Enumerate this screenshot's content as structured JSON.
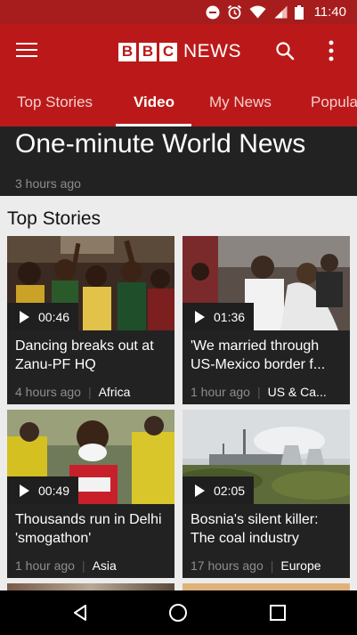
{
  "status_bar": {
    "time": "11:40",
    "icons": [
      "do-not-disturb-icon",
      "alarm-icon",
      "wifi-icon",
      "signal-icon",
      "battery-icon"
    ]
  },
  "app_bar": {
    "logo_letters": [
      "B",
      "B",
      "C"
    ],
    "logo_word": "NEWS",
    "icons": [
      "menu-icon",
      "search-icon",
      "more-vert-icon"
    ]
  },
  "tabs": [
    {
      "label": "Top Stories",
      "active": false
    },
    {
      "label": "Video",
      "active": true
    },
    {
      "label": "My News",
      "active": false
    },
    {
      "label": "Popula",
      "active": false
    }
  ],
  "hero": {
    "title": "One-minute World News",
    "time": "3 hours ago"
  },
  "section": {
    "title": "Top Stories"
  },
  "cards": [
    {
      "duration": "00:46",
      "headline": "Dancing breaks out at Zanu-PF HQ",
      "ago": "4 hours ago",
      "separator": "|",
      "topic": "Africa"
    },
    {
      "duration": "01:36",
      "headline": "'We married through US-Mexico border f...",
      "ago": "1 hour ago",
      "separator": "|",
      "topic": "US & Ca..."
    },
    {
      "duration": "00:49",
      "headline": "Thousands run in Delhi 'smogathon'",
      "ago": "1 hour ago",
      "separator": "|",
      "topic": "Asia"
    },
    {
      "duration": "02:05",
      "headline": "Bosnia's silent killer: The coal industry",
      "ago": "17 hours ago",
      "separator": "|",
      "topic": "Europe"
    }
  ],
  "nav_bar": {
    "icons": [
      "back-icon",
      "home-icon",
      "recents-icon"
    ]
  },
  "colors": {
    "brand_red": "#bb1919",
    "status_red": "#a71d1d",
    "card_bg": "#222222",
    "page_bg": "#ececec"
  }
}
